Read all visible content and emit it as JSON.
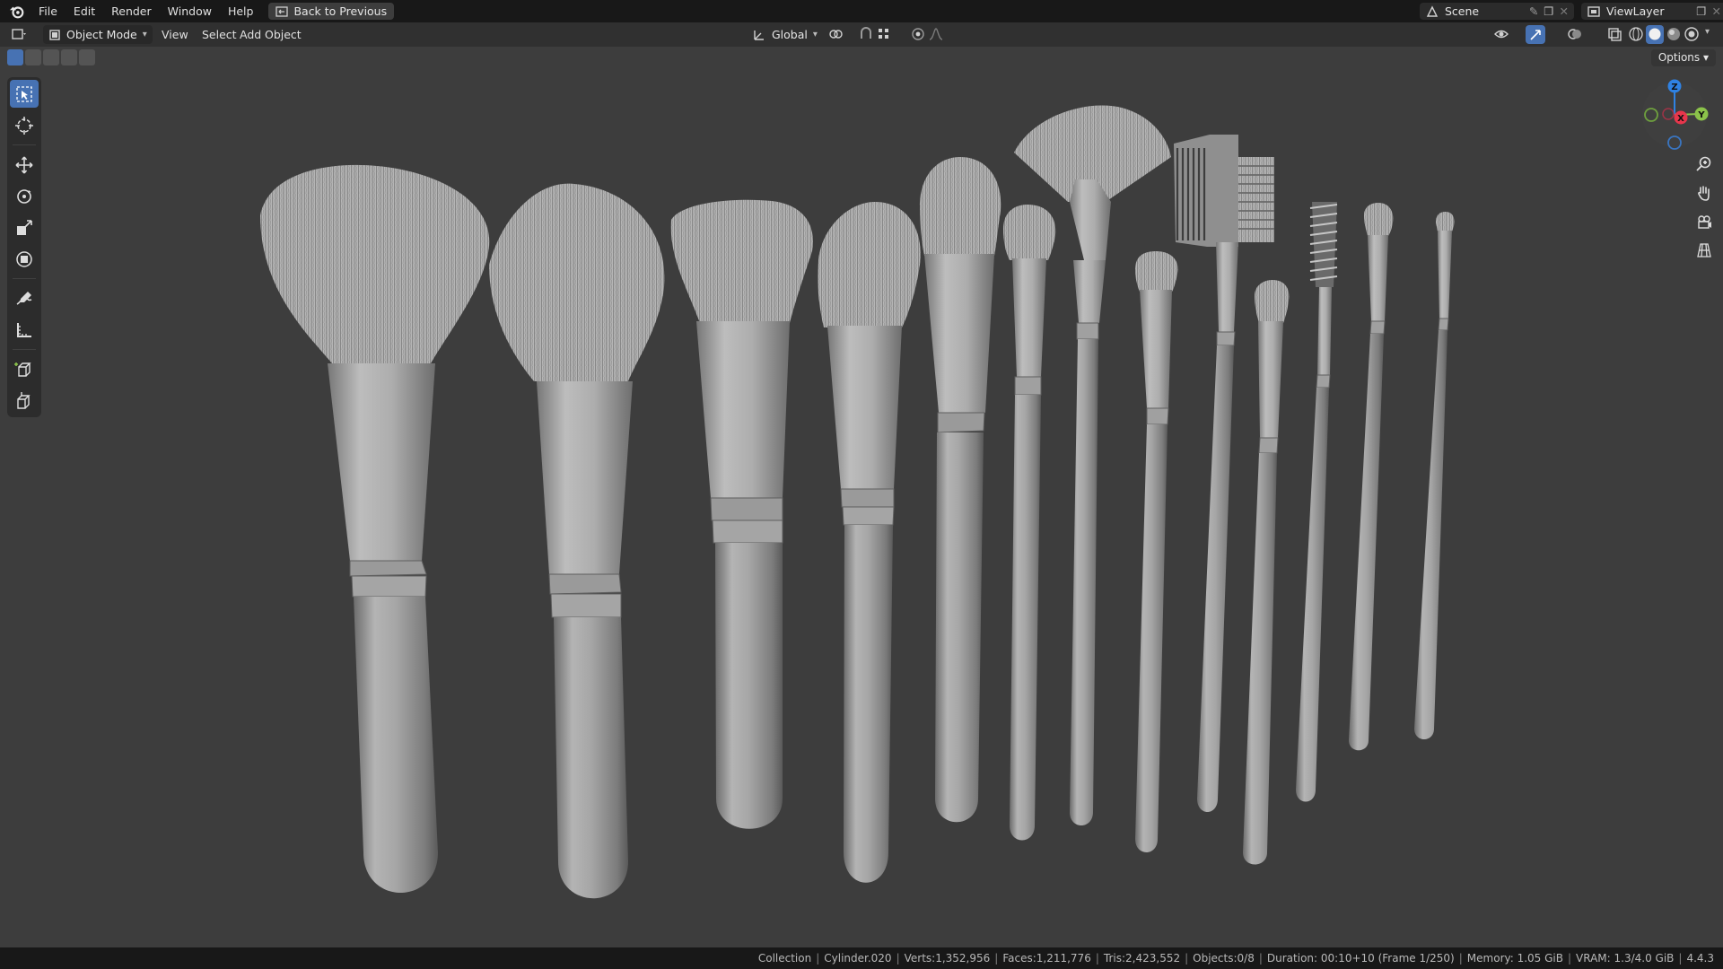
{
  "topbar": {
    "menus": [
      "File",
      "Edit",
      "Render",
      "Window",
      "Help"
    ],
    "back_button": "Back to Previous",
    "scene_name": "Scene",
    "view_layer": "ViewLayer"
  },
  "viewport_header": {
    "mode": "Object Mode",
    "menus": [
      "View",
      "Select",
      "Add",
      "Object"
    ],
    "transform_orientation": "Global"
  },
  "viewport": {
    "options_label": "Options",
    "gizmo_axes": {
      "z": "Z",
      "x": "X",
      "y": "Y"
    }
  },
  "statusbar": {
    "collection": "Collection",
    "object": "Cylinder.020",
    "verts": "Verts:1,352,956",
    "faces": "Faces:1,211,776",
    "tris": "Tris:2,423,552",
    "objects": "Objects:0/8",
    "duration": "Duration: 00:10+10 (Frame 1/250)",
    "memory": "Memory: 1.05 GiB",
    "vram": "VRAM: 1.3/4.0 GiB",
    "version": "4.4.3"
  },
  "colors": {
    "accent": "#4772b3",
    "viewport_bg": "#3d3d3d",
    "axis_x": "#e8364c",
    "axis_y": "#8bc34a",
    "axis_z": "#2f82e3"
  }
}
